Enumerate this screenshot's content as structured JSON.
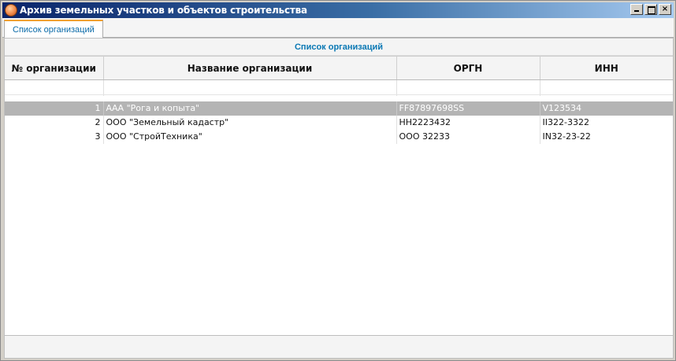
{
  "window": {
    "title": "Архив земельных участков и объектов строительства",
    "buttons": {
      "minimize": "",
      "maximize": "",
      "close": "×"
    }
  },
  "tabs": [
    {
      "label": "Список организаций",
      "active": true
    }
  ],
  "panel": {
    "title": "Список организаций"
  },
  "table": {
    "columns": [
      "№ организации",
      "Название организации",
      "ОРГН",
      "ИНН"
    ],
    "rows": [
      {
        "num": "1",
        "name": "ААА \"Рога и копыта\"",
        "orgn": "FF87897698SS",
        "inn": "V123534",
        "selected": true
      },
      {
        "num": "2",
        "name": "ООО \"Земельный кадастр\"",
        "orgn": "HH2223432",
        "inn": "II322-3322",
        "selected": false
      },
      {
        "num": "3",
        "name": "ООО \"СтройТехника\"",
        "orgn": "ООО 32233",
        "inn": "IN32-23-22",
        "selected": false
      }
    ]
  },
  "colors": {
    "title_start": "#0a246a",
    "title_end": "#a6caf0",
    "accent": "#0a78b4",
    "selection": "#b4b4b4"
  }
}
